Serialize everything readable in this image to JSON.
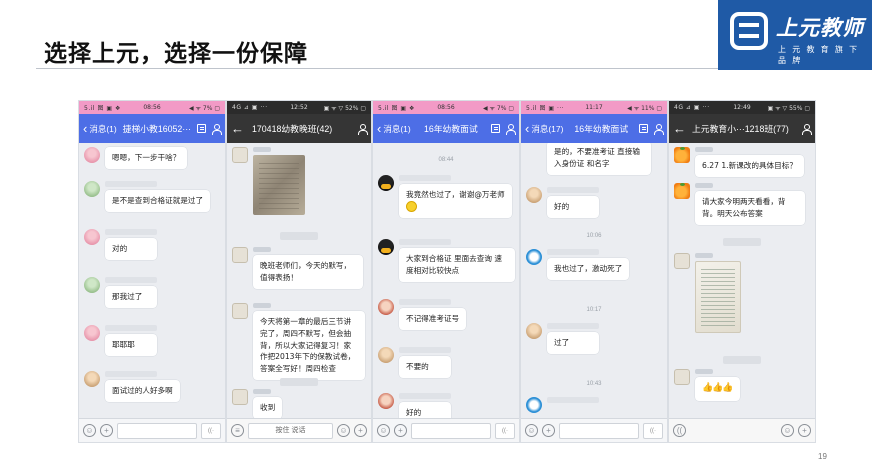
{
  "slide": {
    "title": "选择上元，选择一份保障",
    "page_number": "19",
    "logo": {
      "brand": "上元教师",
      "tagline": "上 元 教 育 旗 下 品 牌"
    }
  },
  "colors": {
    "qq_blue": "#4d6ee6",
    "qq_pink_status": "#f29ac6",
    "dark_status": "#2b2b2b",
    "logo_blue": "#1f5aa6",
    "chat_bg": "#ebedf1"
  },
  "phones": [
    {
      "status": {
        "signal": "5.il 图 ▣ ❖",
        "time": "08:56",
        "right": "◀ ᯤ 7% ▢"
      },
      "back_label": "消息(1)",
      "title": "捷梯小教16052···",
      "messages": [
        {
          "avatar": "pink-flower",
          "text": "嗯嗯，下一步干啥？"
        },
        {
          "avatar": "green-cartoon",
          "text": "是不是查到合格证就是过了"
        },
        {
          "avatar": "pink-flower",
          "text": "对的"
        },
        {
          "avatar": "green-cartoon",
          "text": "那我过了"
        },
        {
          "avatar": "pink-flower",
          "text": "耶耶耶"
        },
        {
          "avatar": "brown-photo",
          "text": "面试过的人好多啊"
        }
      ]
    },
    {
      "status": {
        "signal": "4G ⊿ ▣ ···",
        "time": "12:52",
        "right": "▣ ᯤ ▽ 52% ▢"
      },
      "back_label": "←",
      "title": "170418幼教晚班(42)",
      "messages": [
        {
          "avatar": "sketch",
          "text": ""
        },
        {
          "avatar": "sketch",
          "text": "晚班老师们，今天的默写，值得表扬！"
        },
        {
          "avatar": "sketch",
          "text": "今天将第一章的最后三节讲完了，周四不默写，但会抽背，所以大家记得复习！家作把2013年下的保教试卷，答案全写好！周四检查"
        },
        {
          "avatar": "sketch",
          "text": "收到"
        }
      ],
      "hold_to_talk": "按住 说话"
    },
    {
      "status": {
        "signal": "5.il 图 ▣ ❖",
        "time": "08:56",
        "right": "◀ ᯤ 7% ▢"
      },
      "back_label": "消息(1)",
      "title": "16年幼教面试",
      "time_marker": "08:44",
      "messages": [
        {
          "avatar": "qq-penguin",
          "text": "我竟然也过了，谢谢@万老师"
        },
        {
          "avatar": "qq-penguin",
          "text": "大家到合格证 里面去查询 速度相对比较快点"
        },
        {
          "avatar": "red-girl",
          "text": "不记得准考证号"
        },
        {
          "avatar": "dark-girl",
          "text": "不要的"
        },
        {
          "avatar": "red-girl",
          "text": "好的"
        }
      ]
    },
    {
      "status": {
        "signal": "5.il 图 ▣ ···",
        "time": "11:17",
        "right": "◀ ᯤ 11% ▢"
      },
      "back_label": "消息(17)",
      "title": "16年幼教面试",
      "time_markers": [
        "10:06",
        "10:17",
        "10:43"
      ],
      "messages": [
        {
          "avatar": "none",
          "text": "是的，不要准考证 直接输入身份证 和名字"
        },
        {
          "avatar": "brown-photo",
          "text": "好的"
        },
        {
          "avatar": "doraemon",
          "text": "我也过了，激动死了"
        },
        {
          "avatar": "yellow-doll",
          "text": "过了"
        }
      ]
    },
    {
      "status": {
        "signal": "4G ⊿ ▣ ···",
        "time": "12:49",
        "right": "▣ ᯤ ▽ 55% ▢"
      },
      "back_label": "←",
      "title": "上元教育小···1218班(77)",
      "messages": [
        {
          "avatar": "orange",
          "text": "6.27 1.新课改的具体目标？"
        },
        {
          "avatar": "orange",
          "text": "请大家今明两天看看，背背。明天公布答案"
        },
        {
          "avatar": "sketch",
          "text": ""
        },
        {
          "avatar": "sketch",
          "text": "👍👍👍"
        }
      ]
    }
  ]
}
